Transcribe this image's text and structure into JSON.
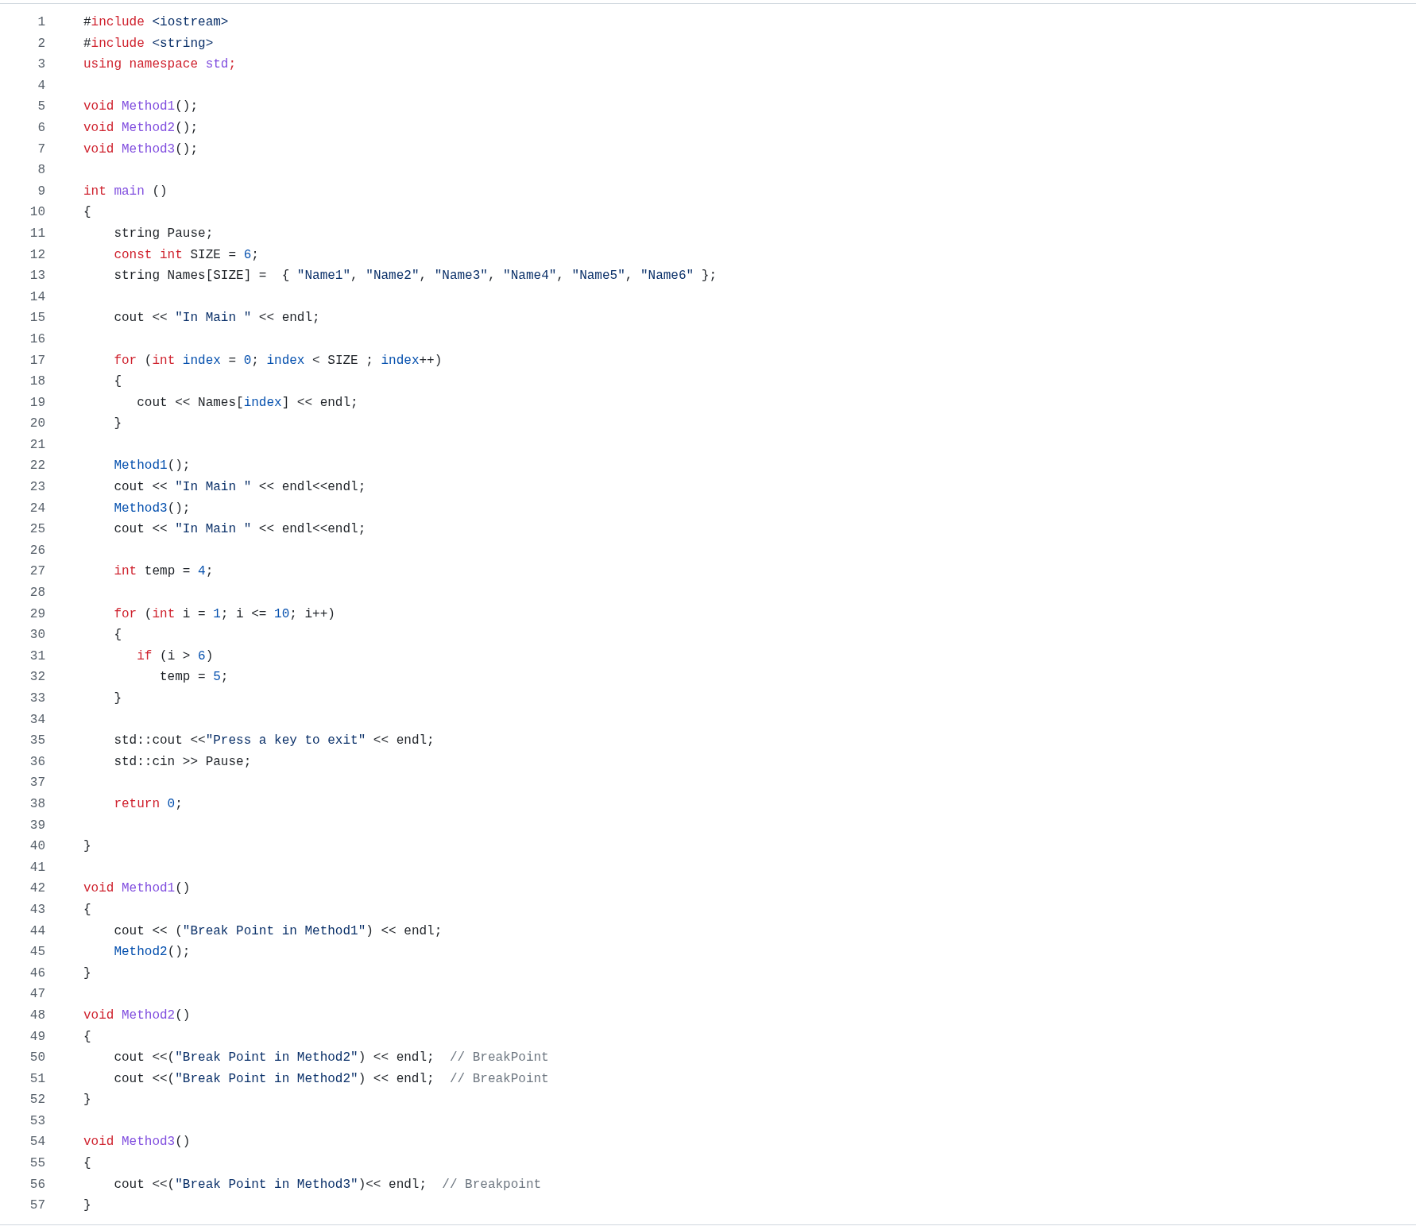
{
  "code_lines": [
    {
      "number": "1",
      "tokens": [
        {
          "kind": "plain",
          "text": "#"
        },
        {
          "kind": "keyword",
          "text": "include"
        },
        {
          "kind": "string",
          "text": " <iostream>"
        }
      ]
    },
    {
      "number": "2",
      "tokens": [
        {
          "kind": "plain",
          "text": "#"
        },
        {
          "kind": "keyword",
          "text": "include"
        },
        {
          "kind": "string",
          "text": " <string>"
        }
      ]
    },
    {
      "number": "3",
      "tokens": [
        {
          "kind": "keyword",
          "text": "using namespace"
        },
        {
          "kind": "entity",
          "text": " std"
        },
        {
          "kind": "keyword",
          "text": ";"
        }
      ]
    },
    {
      "number": "4"
    },
    {
      "number": "5",
      "tokens": [
        {
          "kind": "keyword",
          "text": "void"
        },
        {
          "kind": "entity",
          "text": " Method1"
        },
        {
          "kind": "plain",
          "text": "();"
        }
      ]
    },
    {
      "number": "6",
      "tokens": [
        {
          "kind": "keyword",
          "text": "void"
        },
        {
          "kind": "entity",
          "text": " Method2"
        },
        {
          "kind": "plain",
          "text": "();"
        }
      ]
    },
    {
      "number": "7",
      "tokens": [
        {
          "kind": "keyword",
          "text": "void"
        },
        {
          "kind": "entity",
          "text": " Method3"
        },
        {
          "kind": "plain",
          "text": "();"
        }
      ]
    },
    {
      "number": "8"
    },
    {
      "number": "9",
      "tokens": [
        {
          "kind": "keyword",
          "text": "int"
        },
        {
          "kind": "entity",
          "text": " main"
        },
        {
          "kind": "plain",
          "text": " ()"
        }
      ]
    },
    {
      "number": "10",
      "tokens": [
        {
          "kind": "plain",
          "text": "{"
        }
      ]
    },
    {
      "number": "11",
      "tokens": [
        {
          "kind": "plain",
          "text": "    string Pause;"
        }
      ]
    },
    {
      "number": "12",
      "tokens": [
        {
          "kind": "keyword",
          "text": "    const int"
        },
        {
          "kind": "plain",
          "text": " SIZE ="
        },
        {
          "kind": "constant",
          "text": " 6"
        },
        {
          "kind": "plain",
          "text": ";"
        }
      ]
    },
    {
      "number": "13",
      "tokens": [
        {
          "kind": "plain",
          "text": "    string Names[SIZE] =  {"
        },
        {
          "kind": "string",
          "text": " \"Name1\""
        },
        {
          "kind": "plain",
          "text": ","
        },
        {
          "kind": "string",
          "text": " \"Name2\""
        },
        {
          "kind": "plain",
          "text": ","
        },
        {
          "kind": "string",
          "text": " \"Name3\""
        },
        {
          "kind": "plain",
          "text": ","
        },
        {
          "kind": "string",
          "text": " \"Name4\""
        },
        {
          "kind": "plain",
          "text": ","
        },
        {
          "kind": "string",
          "text": " \"Name5\""
        },
        {
          "kind": "plain",
          "text": ","
        },
        {
          "kind": "string",
          "text": " \"Name6\""
        },
        {
          "kind": "plain",
          "text": " };"
        }
      ]
    },
    {
      "number": "14"
    },
    {
      "number": "15",
      "tokens": [
        {
          "kind": "plain",
          "text": "    cout <<"
        },
        {
          "kind": "string",
          "text": " \"In Main \""
        },
        {
          "kind": "plain",
          "text": " << endl;"
        }
      ]
    },
    {
      "number": "16"
    },
    {
      "number": "17",
      "tokens": [
        {
          "kind": "keyword",
          "text": "    for"
        },
        {
          "kind": "plain",
          "text": " ("
        },
        {
          "kind": "keyword",
          "text": "int"
        },
        {
          "kind": "constant",
          "text": " index"
        },
        {
          "kind": "plain",
          "text": " ="
        },
        {
          "kind": "constant",
          "text": " 0"
        },
        {
          "kind": "plain",
          "text": ";"
        },
        {
          "kind": "constant",
          "text": " index"
        },
        {
          "kind": "plain",
          "text": " < SIZE ;"
        },
        {
          "kind": "constant",
          "text": " index"
        },
        {
          "kind": "plain",
          "text": "++)"
        }
      ]
    },
    {
      "number": "18",
      "tokens": [
        {
          "kind": "plain",
          "text": "    {"
        }
      ]
    },
    {
      "number": "19",
      "tokens": [
        {
          "kind": "plain",
          "text": "       cout << Names["
        },
        {
          "kind": "constant",
          "text": "index"
        },
        {
          "kind": "plain",
          "text": "] << endl;"
        }
      ]
    },
    {
      "number": "20",
      "tokens": [
        {
          "kind": "plain",
          "text": "    }"
        }
      ]
    },
    {
      "number": "21"
    },
    {
      "number": "22",
      "tokens": [
        {
          "kind": "constant",
          "text": "    Method1"
        },
        {
          "kind": "plain",
          "text": "();"
        }
      ]
    },
    {
      "number": "23",
      "tokens": [
        {
          "kind": "plain",
          "text": "    cout <<"
        },
        {
          "kind": "string",
          "text": " \"In Main \""
        },
        {
          "kind": "plain",
          "text": " << endl<<endl;"
        }
      ]
    },
    {
      "number": "24",
      "tokens": [
        {
          "kind": "constant",
          "text": "    Method3"
        },
        {
          "kind": "plain",
          "text": "();"
        }
      ]
    },
    {
      "number": "25",
      "tokens": [
        {
          "kind": "plain",
          "text": "    cout <<"
        },
        {
          "kind": "string",
          "text": " \"In Main \""
        },
        {
          "kind": "plain",
          "text": " << endl<<endl;"
        }
      ]
    },
    {
      "number": "26"
    },
    {
      "number": "27",
      "tokens": [
        {
          "kind": "keyword",
          "text": "    int"
        },
        {
          "kind": "plain",
          "text": " temp ="
        },
        {
          "kind": "constant",
          "text": " 4"
        },
        {
          "kind": "plain",
          "text": ";"
        }
      ]
    },
    {
      "number": "28"
    },
    {
      "number": "29",
      "tokens": [
        {
          "kind": "keyword",
          "text": "    for"
        },
        {
          "kind": "plain",
          "text": " ("
        },
        {
          "kind": "keyword",
          "text": "int"
        },
        {
          "kind": "plain",
          "text": " i ="
        },
        {
          "kind": "constant",
          "text": " 1"
        },
        {
          "kind": "plain",
          "text": "; i <="
        },
        {
          "kind": "constant",
          "text": " 10"
        },
        {
          "kind": "plain",
          "text": "; i++)"
        }
      ]
    },
    {
      "number": "30",
      "tokens": [
        {
          "kind": "plain",
          "text": "    {"
        }
      ]
    },
    {
      "number": "31",
      "tokens": [
        {
          "kind": "keyword",
          "text": "       if"
        },
        {
          "kind": "plain",
          "text": " (i >"
        },
        {
          "kind": "constant",
          "text": " 6"
        },
        {
          "kind": "plain",
          "text": ")"
        }
      ]
    },
    {
      "number": "32",
      "tokens": [
        {
          "kind": "plain",
          "text": "          temp ="
        },
        {
          "kind": "constant",
          "text": " 5"
        },
        {
          "kind": "plain",
          "text": ";"
        }
      ]
    },
    {
      "number": "33",
      "tokens": [
        {
          "kind": "plain",
          "text": "    }"
        }
      ]
    },
    {
      "number": "34"
    },
    {
      "number": "35",
      "tokens": [
        {
          "kind": "plain",
          "text": "    std::cout <<"
        },
        {
          "kind": "string",
          "text": "\"Press a key to exit\""
        },
        {
          "kind": "plain",
          "text": " << endl;"
        }
      ]
    },
    {
      "number": "36",
      "tokens": [
        {
          "kind": "plain",
          "text": "    std::cin >> Pause;"
        }
      ]
    },
    {
      "number": "37"
    },
    {
      "number": "38",
      "tokens": [
        {
          "kind": "keyword",
          "text": "    return"
        },
        {
          "kind": "constant",
          "text": " 0"
        },
        {
          "kind": "plain",
          "text": ";"
        }
      ]
    },
    {
      "number": "39"
    },
    {
      "number": "40",
      "tokens": [
        {
          "kind": "plain",
          "text": "}"
        }
      ]
    },
    {
      "number": "41"
    },
    {
      "number": "42",
      "tokens": [
        {
          "kind": "keyword",
          "text": "void"
        },
        {
          "kind": "entity",
          "text": " Method1"
        },
        {
          "kind": "plain",
          "text": "()"
        }
      ]
    },
    {
      "number": "43",
      "tokens": [
        {
          "kind": "plain",
          "text": "{"
        }
      ]
    },
    {
      "number": "44",
      "tokens": [
        {
          "kind": "plain",
          "text": "    cout << ("
        },
        {
          "kind": "string",
          "text": "\"Break Point in Method1\""
        },
        {
          "kind": "plain",
          "text": ") << endl;"
        }
      ]
    },
    {
      "number": "45",
      "tokens": [
        {
          "kind": "constant",
          "text": "    Method2"
        },
        {
          "kind": "plain",
          "text": "();"
        }
      ]
    },
    {
      "number": "46",
      "tokens": [
        {
          "kind": "plain",
          "text": "}"
        }
      ]
    },
    {
      "number": "47"
    },
    {
      "number": "48",
      "tokens": [
        {
          "kind": "keyword",
          "text": "void"
        },
        {
          "kind": "entity",
          "text": " Method2"
        },
        {
          "kind": "plain",
          "text": "()"
        }
      ]
    },
    {
      "number": "49",
      "tokens": [
        {
          "kind": "plain",
          "text": "{"
        }
      ]
    },
    {
      "number": "50",
      "tokens": [
        {
          "kind": "plain",
          "text": "    cout <<("
        },
        {
          "kind": "string",
          "text": "\"Break Point in Method2\""
        },
        {
          "kind": "plain",
          "text": ") << endl;"
        },
        {
          "kind": "comment",
          "text": "  // BreakPoint"
        }
      ]
    },
    {
      "number": "51",
      "tokens": [
        {
          "kind": "plain",
          "text": "    cout <<("
        },
        {
          "kind": "string",
          "text": "\"Break Point in Method2\""
        },
        {
          "kind": "plain",
          "text": ") << endl;"
        },
        {
          "kind": "comment",
          "text": "  // BreakPoint"
        }
      ]
    },
    {
      "number": "52",
      "tokens": [
        {
          "kind": "plain",
          "text": "}"
        }
      ]
    },
    {
      "number": "53"
    },
    {
      "number": "54",
      "tokens": [
        {
          "kind": "keyword",
          "text": "void"
        },
        {
          "kind": "entity",
          "text": " Method3"
        },
        {
          "kind": "plain",
          "text": "()"
        }
      ]
    },
    {
      "number": "55",
      "tokens": [
        {
          "kind": "plain",
          "text": "{"
        }
      ]
    },
    {
      "number": "56",
      "tokens": [
        {
          "kind": "plain",
          "text": "    cout <<("
        },
        {
          "kind": "string",
          "text": "\"Break Point in Method3\""
        },
        {
          "kind": "plain",
          "text": ")<< endl;"
        },
        {
          "kind": "comment",
          "text": "  // Breakpoint"
        }
      ]
    },
    {
      "number": "57",
      "tokens": [
        {
          "kind": "plain",
          "text": "}"
        }
      ]
    }
  ]
}
